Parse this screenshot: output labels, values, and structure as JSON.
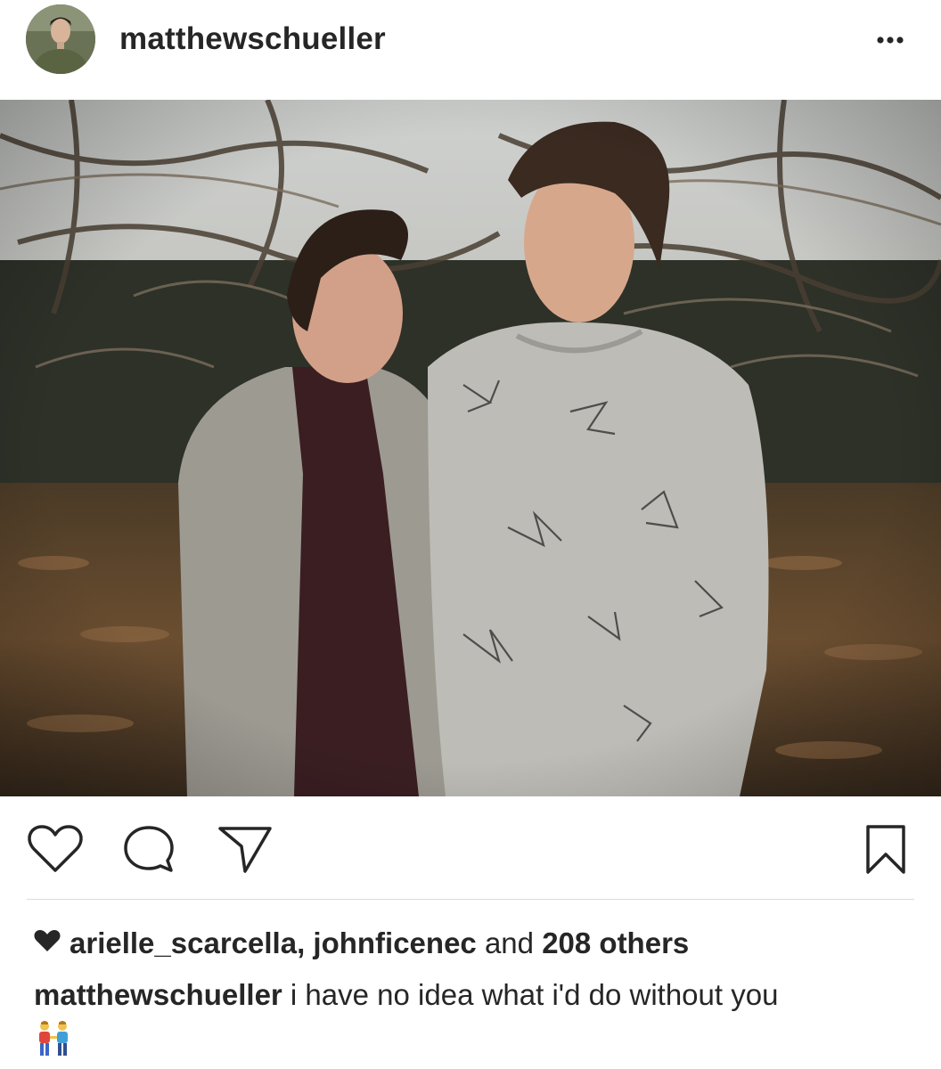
{
  "header": {
    "username": "matthewschueller",
    "avatar_icon": "profile-avatar",
    "more_icon": "ellipsis-icon"
  },
  "post": {
    "photo_alt": "Two men smiling at each other in front of autumn trees"
  },
  "actions": {
    "like_icon": "heart-outline-icon",
    "comment_icon": "comment-bubble-icon",
    "share_icon": "paper-plane-icon",
    "save_icon": "bookmark-icon"
  },
  "likes": {
    "heart_icon": "heart-filled-icon",
    "user1": "arielle_scarcella",
    "separator": ", ",
    "user2": "johnficenec",
    "and_text": " and ",
    "others": "208 others"
  },
  "caption": {
    "username": "matthewschueller",
    "text": " i have no idea what i'd do without you",
    "emoji_icon": "two-men-holding-hands-emoji"
  },
  "colors": {
    "text": "#262626",
    "divider": "#dbdbdb"
  }
}
